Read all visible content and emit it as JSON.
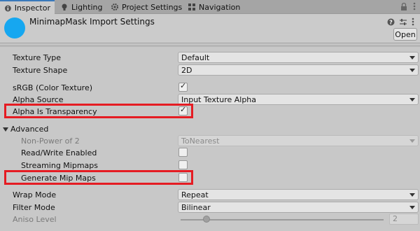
{
  "tabs": [
    {
      "label": "Inspector",
      "icon": "info-icon"
    },
    {
      "label": "Lighting",
      "icon": "bulb-icon"
    },
    {
      "label": "Project Settings",
      "icon": "gear-icon"
    },
    {
      "label": "Navigation",
      "icon": "navigation-icon"
    }
  ],
  "header": {
    "title": "MinimapMask Import Settings",
    "open_label": "Open",
    "asset_color": "#16a7f0"
  },
  "props": {
    "texture_type": {
      "label": "Texture Type",
      "value": "Default"
    },
    "texture_shape": {
      "label": "Texture Shape",
      "value": "2D"
    },
    "srgb": {
      "label": "sRGB (Color Texture)",
      "checked": true
    },
    "alpha_source": {
      "label": "Alpha Source",
      "value": "Input Texture Alpha"
    },
    "alpha_transparency": {
      "label": "Alpha Is Transparency",
      "checked": true
    },
    "advanced": {
      "label": "Advanced"
    },
    "non_power_of_2": {
      "label": "Non-Power of 2",
      "value": "ToNearest"
    },
    "read_write": {
      "label": "Read/Write Enabled",
      "checked": false
    },
    "streaming_mipmaps": {
      "label": "Streaming Mipmaps",
      "checked": false
    },
    "generate_mip_maps": {
      "label": "Generate Mip Maps",
      "checked": false
    },
    "wrap_mode": {
      "label": "Wrap Mode",
      "value": "Repeat"
    },
    "filter_mode": {
      "label": "Filter Mode",
      "value": "Bilinear"
    },
    "aniso_level": {
      "label": "Aniso Level",
      "value": "2"
    }
  },
  "tick_char": "✓",
  "highlight_color": "#e51c23"
}
